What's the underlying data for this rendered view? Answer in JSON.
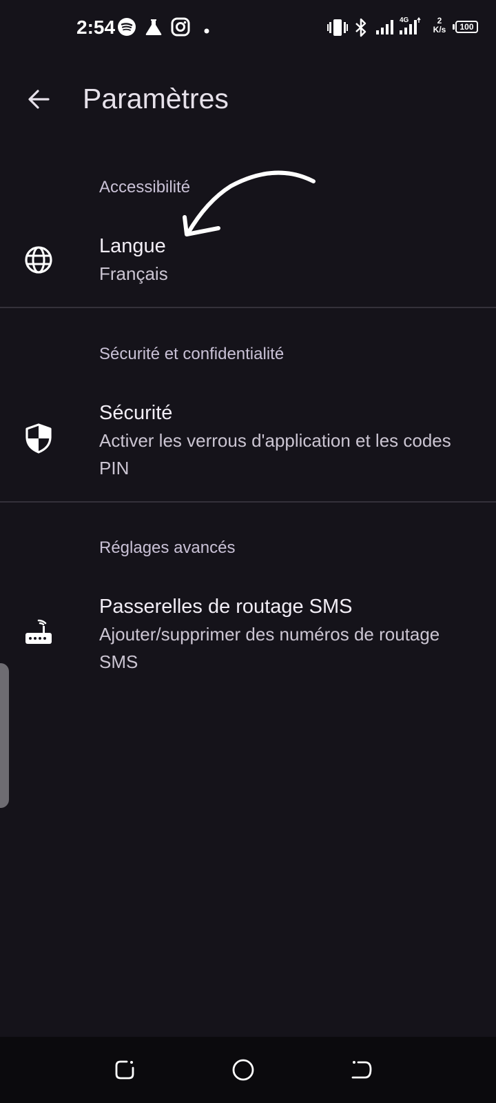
{
  "status_bar": {
    "time": "2:54",
    "icons": [
      "spotify-icon",
      "flask-icon",
      "instagram-icon",
      "dot-icon",
      "vibrate-icon",
      "bluetooth-icon",
      "signal-icon",
      "signal-4g-icon"
    ],
    "network_speed_value": "2",
    "network_speed_unit": "K/s",
    "battery": "100"
  },
  "app_bar": {
    "back_icon": "arrow-left-icon",
    "title": "Paramètres"
  },
  "sections": [
    {
      "header": "Accessibilité",
      "items": [
        {
          "icon": "globe-icon",
          "title": "Langue",
          "subtitle": "Français"
        }
      ]
    },
    {
      "header": "Sécurité et confidentialité",
      "items": [
        {
          "icon": "shield-icon",
          "title": "Sécurité",
          "subtitle": "Activer les verrous d'application et les codes PIN"
        }
      ]
    },
    {
      "header": "Réglages avancés",
      "items": [
        {
          "icon": "router-icon",
          "title": "Passerelles de routage SMS",
          "subtitle": "Ajouter/supprimer des numéros de routage SMS"
        }
      ]
    }
  ],
  "nav_bar": {
    "icons": [
      "recents-icon",
      "home-icon",
      "back-nav-icon"
    ]
  },
  "colors": {
    "background": "#15131a",
    "text_primary": "#f2eef6",
    "text_secondary": "#cbc5d2",
    "section_header": "#c9c1d6",
    "divider": "#34313a",
    "nav_background": "#0b0a0d"
  }
}
